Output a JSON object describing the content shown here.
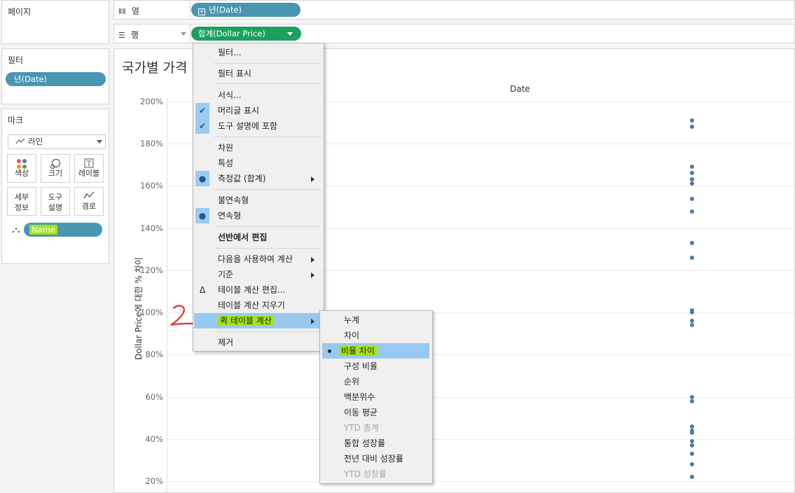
{
  "left": {
    "pages_title": "페이지",
    "filters_title": "필터",
    "filter_pill": "년(Date)",
    "marks_title": "마크",
    "mark_type": "라인",
    "buttons": {
      "color": "색상",
      "size": "크기",
      "label": "레이블",
      "detail": "세부\n정보",
      "tooltip": "도구\n설명",
      "path": "경로"
    },
    "name_pill": "Name"
  },
  "shelves": {
    "columns_label": "열",
    "rows_label": "행",
    "columns_pill": "년(Date)",
    "rows_pill": "합계(Dollar Price)"
  },
  "view": {
    "title": "국가별 가격",
    "header": "Date",
    "y_axis_title": "Dollar Price에 대한 % 차이",
    "ticks": [
      "200%",
      "180%",
      "160%",
      "140%",
      "120%",
      "100%",
      "80%",
      "60%",
      "40%",
      "20%"
    ]
  },
  "chart_data": {
    "type": "scatter",
    "ylabel": "Dollar Price에 대한 % 차이",
    "ylim": [
      20,
      200
    ],
    "x": [
      "Date"
    ],
    "values": [
      191,
      188,
      169,
      166,
      163,
      161,
      154,
      148,
      133,
      126,
      101,
      100,
      96,
      94,
      60,
      58,
      46,
      44,
      43,
      39,
      37,
      33,
      28,
      22
    ]
  },
  "menu": {
    "items": [
      "필터...",
      "필터 표시",
      "서식...",
      "머리글 표시",
      "도구 설명에 포함",
      "차원",
      "특성",
      "측정값 (합계)",
      "불연속형",
      "연속형",
      "선반에서 편집",
      "다음을 사용하여 계산",
      "기준",
      "테이블 계산 편집...",
      "테이블 계산 지우기",
      "퀵 테이블 계산",
      "제거"
    ],
    "delta": "Δ"
  },
  "submenu": {
    "items": [
      "누계",
      "차이",
      "비율 차이",
      "구성 비율",
      "순위",
      "백분위수",
      "이동 평균",
      "YTD 총계",
      "통합 성장률",
      "전년 대비 성장률",
      "YTD 성장률"
    ]
  },
  "colors": {
    "pill_blue": "#4996b2",
    "pill_green": "#1aa15f",
    "dot": "#4e79a7",
    "highlight": "#a4e21c",
    "menu_selection": "#99c9f0"
  }
}
